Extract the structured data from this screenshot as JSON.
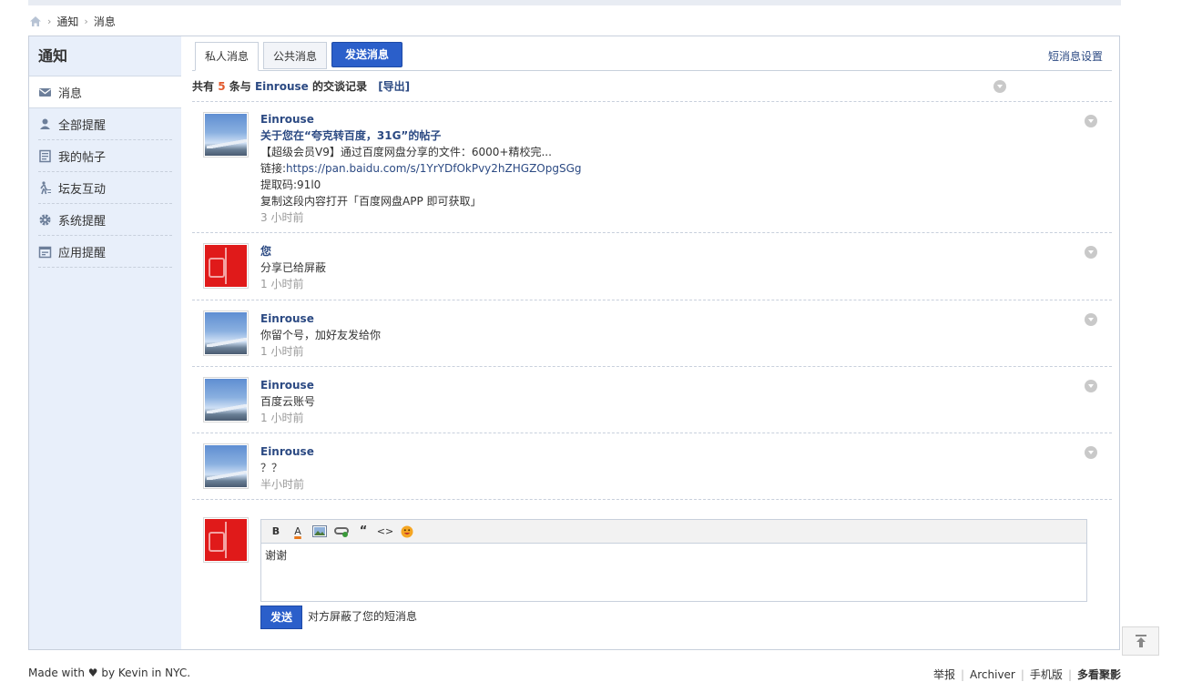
{
  "breadcrumb": {
    "items": [
      "通知",
      "消息"
    ],
    "sep": "›"
  },
  "sidebar": {
    "title": "通知",
    "items": [
      {
        "label": "消息",
        "icon": "envelope-icon",
        "active": true
      },
      {
        "label": "全部提醒",
        "icon": "user-icon"
      },
      {
        "label": "我的帖子",
        "icon": "document-icon"
      },
      {
        "label": "坛友互动",
        "icon": "walking-person-icon"
      },
      {
        "label": "系统提醒",
        "icon": "gear-icon"
      },
      {
        "label": "应用提醒",
        "icon": "calendar-icon"
      }
    ]
  },
  "tabs": {
    "private": "私人消息",
    "public": "公共消息",
    "send": "发送消息",
    "settings": "短消息设置"
  },
  "summary": {
    "prefix": "共有",
    "count": "5",
    "middle": "条与",
    "name": "Einrouse",
    "suffix": "的交谈记录",
    "export": "[导出]"
  },
  "messages": [
    {
      "author": "Einrouse",
      "title": "关于您在“夸克转百度，31G”的帖子",
      "lines": [
        "【超级会员V9】通过百度网盘分享的文件：6000+精校完...",
        "提取码:91l0",
        "复制这段内容打开「百度网盘APP 即可获取」"
      ],
      "link_prefix": "链接:",
      "link": "https://pan.baidu.com/s/1YrYDfOkPvy2hZHGZOpgSGg",
      "time": "3 小时前"
    },
    {
      "author": "您",
      "text": "分享已给屏蔽",
      "time": "1 小时前"
    },
    {
      "author": "Einrouse",
      "text": "你留个号，加好友发给你",
      "time": "1 小时前"
    },
    {
      "author": "Einrouse",
      "text": "百度云账号",
      "time": "1 小时前"
    },
    {
      "author": "Einrouse",
      "text": "？？",
      "time": "半小时前"
    }
  ],
  "reply": {
    "value": "谢谢",
    "send_label": "发送",
    "note": "对方屏蔽了您的短消息",
    "toolbar": {
      "bold": "B",
      "color": "A",
      "quote": "“",
      "code": "<>"
    }
  },
  "footer": {
    "left": "Made with ♥ by Kevin in NYC.",
    "links": [
      "举报",
      "Archiver",
      "手机版"
    ],
    "brand": "多看聚影",
    "sep": "|"
  },
  "colors": {
    "accent": "#2b5fca",
    "link": "#2c4a83",
    "sidebar_bg": "#e8effa",
    "count": "#e25a2e"
  }
}
